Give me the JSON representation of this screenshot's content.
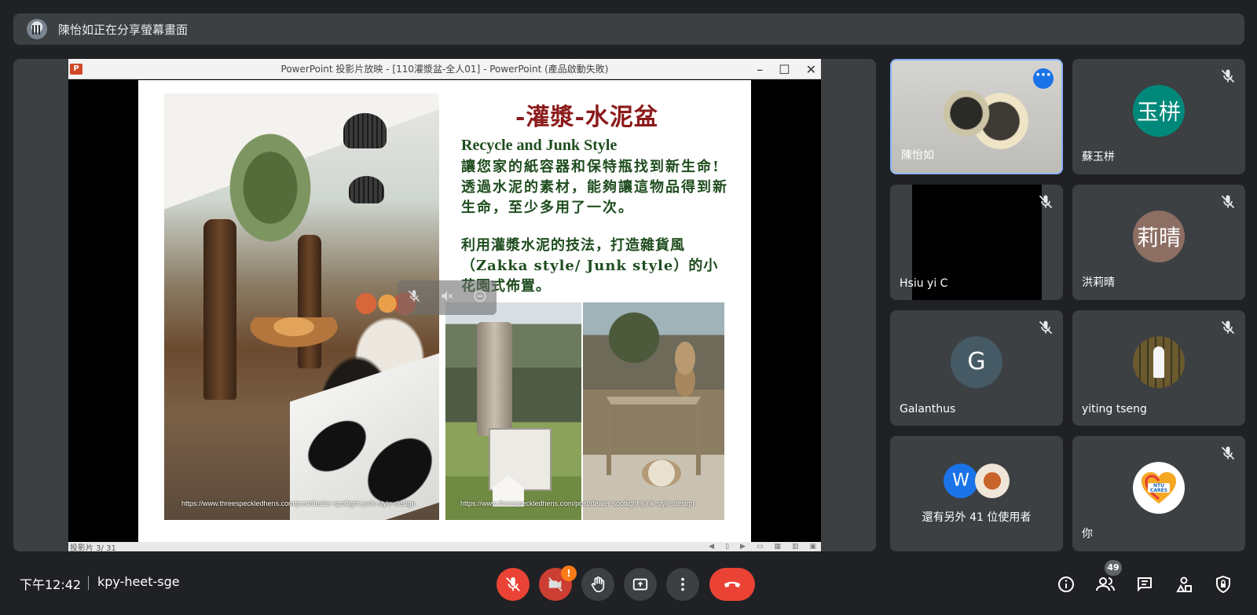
{
  "banner": {
    "text": "陳怡如正在分享螢幕畫面"
  },
  "ppt": {
    "window_title": "PowerPoint 投影片放映 - [110灌漿盆-全人01] - PowerPoint (產品啟動失敗)",
    "logo": "P",
    "status": "投影片 3/ 31",
    "slide": {
      "title": "-灌漿-水泥盆",
      "subtitle": "Recycle and Junk Style",
      "body1": "讓您家的紙容器和保特瓶找到新生命!透過水泥的素材，能夠讓這物品得到新生命，至少多用了一次。",
      "body2": "利用灌漿水泥的技法，打造雜貨風（Zakka style/ Junk style）的小花園式佈置。",
      "credit1": "https://www.threespeckledhens.com/post/dealer-spotlight-junk-style-design",
      "credit2": "https://www.threespeckledhens.com/post/dealer-spotlight-junk-style-design"
    }
  },
  "participants": [
    {
      "name": "陳怡如",
      "type": "video",
      "active": true
    },
    {
      "name": "蘇玉栟",
      "initials": "玉栟",
      "color": "#0b8043"
    },
    {
      "name": "Hsiu yi C",
      "type": "video-black"
    },
    {
      "name": "洪莉晴",
      "initials": "莉晴",
      "color": "#8d6e63"
    },
    {
      "name": "Galanthus",
      "initials": "G",
      "color": "#455a64"
    },
    {
      "name": "yiting tseng",
      "type": "photo"
    },
    {
      "name": "還有另外 41 位使用者",
      "initials": "W",
      "color": "#1a73e8"
    },
    {
      "name": "你",
      "type": "logo",
      "logo_text": "NTU CARES"
    }
  ],
  "bottom": {
    "time": "下午12:42",
    "meeting_code": "kpy-heet-sge",
    "warn_badge": "!",
    "people_count": "49"
  },
  "colors": {
    "background": "#202124",
    "tile": "#3c4043",
    "accent_red": "#ea4335",
    "accent_blue": "#1a73e8"
  }
}
